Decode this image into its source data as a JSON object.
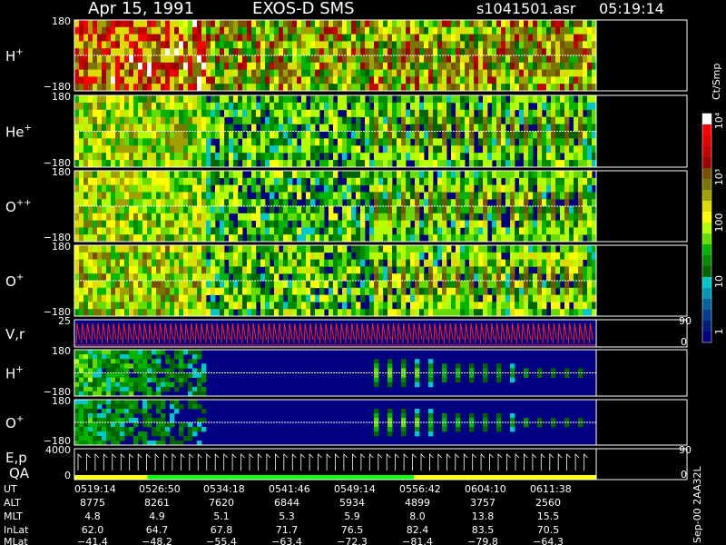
{
  "header": {
    "date": "Apr 15, 1991",
    "instrument": "EXOS-D SMS",
    "file": "s1041501.asr",
    "time": "05:19:14"
  },
  "colorbar": {
    "label": "Ct/Smp",
    "ticks": [
      "10⁴",
      "10³",
      "100",
      "10",
      "1"
    ],
    "colors": [
      "#ffffff",
      "#ff0000",
      "#e60000",
      "#c80000",
      "#a00000",
      "#785000",
      "#787800",
      "#a0a000",
      "#dcdc00",
      "#ffff00",
      "#b4ff00",
      "#64dc00",
      "#00b400",
      "#008c00",
      "#006400",
      "#00c8c8",
      "#0096b4",
      "#0064a0",
      "#003c8c",
      "#001e78",
      "#000080"
    ]
  },
  "panels": [
    {
      "label_main": "H",
      "label_sup": "+",
      "ymax": "180",
      "ymin": "−180",
      "type": "spectrogram",
      "intensity": 0.85
    },
    {
      "label_main": "He",
      "label_sup": "+",
      "ymax": "180",
      "ymin": "−180",
      "type": "spectrogram",
      "intensity": 0.55
    },
    {
      "label_main": "O",
      "label_sup": "++",
      "ymax": "180",
      "ymin": "−180",
      "type": "spectrogram",
      "intensity": 0.55
    },
    {
      "label_main": "O",
      "label_sup": "+",
      "ymax": "180",
      "ymin": "−180",
      "type": "spectrogram",
      "intensity": 0.6
    },
    {
      "label_main": "V,r",
      "label_sup": "",
      "ymax": "25",
      "ymin": "",
      "right_top": "90",
      "right_bottom": "0",
      "type": "sweep"
    },
    {
      "label_main": "H",
      "label_sup": "+",
      "ymax": "180",
      "ymin": "−180",
      "type": "spectrogram",
      "intensity": 0.35
    },
    {
      "label_main": "O",
      "label_sup": "+",
      "ymax": "180",
      "ymin": "−180",
      "type": "spectrogram",
      "intensity": 0.3
    },
    {
      "label_main": "E,p",
      "label_sup": "",
      "label_second": "QA",
      "ymax": "4000",
      "ymin": "0",
      "right_top": "90",
      "right_bottom": "0",
      "type": "ep"
    }
  ],
  "side_note": "Sep-00 2AA32L",
  "table": {
    "row_labels": [
      "UT",
      "ALT",
      "MLT",
      "InLat",
      "MLat"
    ],
    "columns": [
      [
        "0519:14",
        "8775",
        "4.8",
        "62.0",
        "−41.4"
      ],
      [
        "0526:50",
        "8261",
        "4.9",
        "64.7",
        "−48.2"
      ],
      [
        "0534:18",
        "7620",
        "5.1",
        "67.8",
        "−55.4"
      ],
      [
        "0541:46",
        "6844",
        "5.3",
        "71.7",
        "−63.4"
      ],
      [
        "0549:14",
        "5934",
        "5.9",
        "76.5",
        "−72.3"
      ],
      [
        "0556:42",
        "4899",
        "8.0",
        "82.4",
        "−81.4"
      ],
      [
        "0604:10",
        "3757",
        "13.8",
        "83.5",
        "−79.8"
      ],
      [
        "0611:38",
        "2560",
        "15.5",
        "70.5",
        "−64.3"
      ]
    ]
  },
  "chart_data": {
    "type": "heatmap",
    "title": "Apr 15, 1991 EXOS-D SMS",
    "x": [
      "0519:14",
      "0526:50",
      "0534:18",
      "0541:46",
      "0549:14",
      "0556:42",
      "0604:10",
      "0611:38"
    ],
    "series": [
      {
        "name": "H+",
        "ylim": [
          -180,
          180
        ]
      },
      {
        "name": "He+",
        "ylim": [
          -180,
          180
        ]
      },
      {
        "name": "O++",
        "ylim": [
          -180,
          180
        ]
      },
      {
        "name": "O+",
        "ylim": [
          -180,
          180
        ]
      },
      {
        "name": "V,r",
        "ylim": [
          0,
          25
        ]
      },
      {
        "name": "H+",
        "ylim": [
          -180,
          180
        ]
      },
      {
        "name": "O+",
        "ylim": [
          -180,
          180
        ]
      },
      {
        "name": "E,p",
        "ylim": [
          0,
          4000
        ]
      }
    ],
    "color_scale": {
      "label": "Ct/Smp",
      "ticks": [
        "1",
        "10",
        "100",
        "10³",
        "10⁴"
      ],
      "log": true
    }
  }
}
